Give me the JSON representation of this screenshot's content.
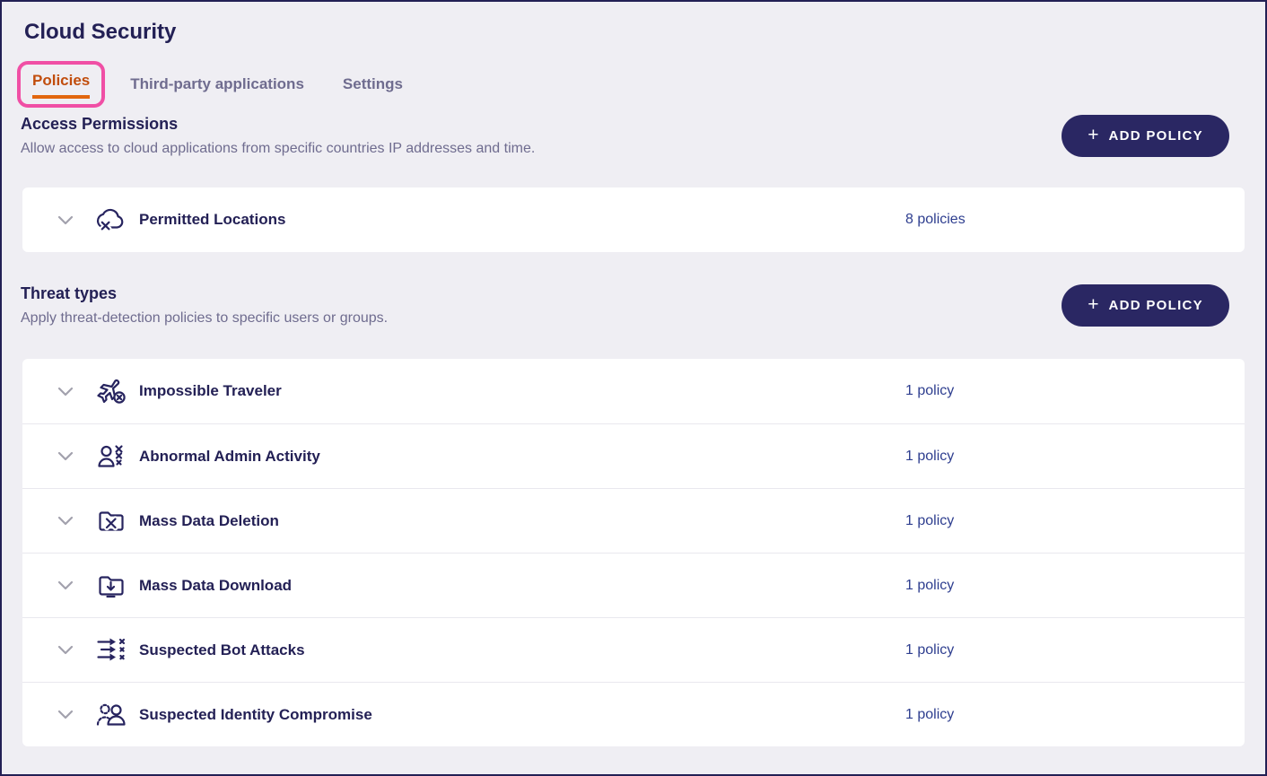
{
  "page": {
    "title": "Cloud Security"
  },
  "icons": {
    "plus": "+"
  },
  "tabs": [
    {
      "label": "Policies",
      "active": true,
      "highlighted": true
    },
    {
      "label": "Third-party applications",
      "active": false
    },
    {
      "label": "Settings",
      "active": false
    }
  ],
  "sections": [
    {
      "heading": "Access Permissions",
      "description": "Allow access to cloud applications from specific countries IP addresses and time.",
      "button_label": "ADD POLICY",
      "rows": [
        {
          "icon": "cloud-location-icon",
          "label": "Permitted Locations",
          "count": "8 policies"
        }
      ]
    },
    {
      "heading": "Threat types",
      "description": "Apply threat-detection policies to specific users or groups.",
      "button_label": "ADD POLICY",
      "rows": [
        {
          "icon": "airplane-x-icon",
          "label": "Impossible Traveler",
          "count": "1 policy"
        },
        {
          "icon": "admin-x-icon",
          "label": "Abnormal Admin Activity",
          "count": "1 policy"
        },
        {
          "icon": "folder-x-icon",
          "label": "Mass Data Deletion",
          "count": "1 policy"
        },
        {
          "icon": "folder-download-icon",
          "label": "Mass Data Download",
          "count": "1 policy"
        },
        {
          "icon": "bot-attacks-icon",
          "label": "Suspected Bot Attacks",
          "count": "1 policy"
        },
        {
          "icon": "identity-compromise-icon",
          "label": "Suspected Identity Compromise",
          "count": "1 policy"
        }
      ]
    }
  ],
  "colors": {
    "accent_navy": "#232055",
    "button_navy": "#2a2763",
    "active_tab_text": "#c14d0d",
    "active_tab_underline": "#e2660e",
    "annotation_pink": "#f04fa5",
    "muted_text": "#6f6c8f",
    "count_text": "#2e3e8f",
    "background": "#efeef3",
    "card_background": "#ffffff",
    "separator": "#e9e8ee"
  }
}
